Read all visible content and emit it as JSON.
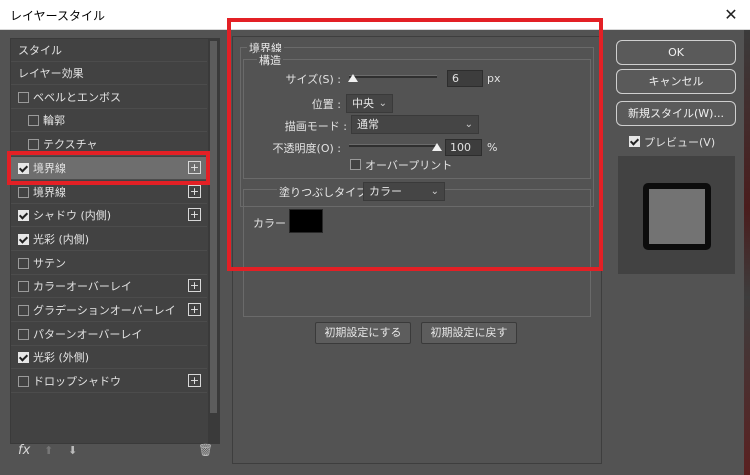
{
  "window": {
    "title": "レイヤースタイル",
    "close": "✕"
  },
  "left_panel": {
    "header_style": "スタイル",
    "header_effects": "レイヤー効果",
    "items": [
      {
        "label": "ベベルとエンボス",
        "checked": false,
        "plus": false
      },
      {
        "label": "輪郭",
        "checked": false,
        "plus": false
      },
      {
        "label": "テクスチャ",
        "checked": false,
        "plus": false
      },
      {
        "label": "境界線",
        "checked": true,
        "plus": true
      },
      {
        "label": "境界線",
        "checked": false,
        "plus": true
      },
      {
        "label": "シャドウ (内側)",
        "checked": true,
        "plus": true
      },
      {
        "label": "光彩 (内側)",
        "checked": true,
        "plus": false
      },
      {
        "label": "サテン",
        "checked": false,
        "plus": false
      },
      {
        "label": "カラーオーバーレイ",
        "checked": false,
        "plus": true
      },
      {
        "label": "グラデーションオーバーレイ",
        "checked": false,
        "plus": true
      },
      {
        "label": "パターンオーバーレイ",
        "checked": false,
        "plus": false
      },
      {
        "label": "光彩 (外側)",
        "checked": true,
        "plus": false
      },
      {
        "label": "ドロップシャドウ",
        "checked": false,
        "plus": true
      }
    ],
    "plus_symbol": "+",
    "fx": "fx",
    "up": "⬆",
    "down": "⬇",
    "trash": "🗑"
  },
  "stroke": {
    "title": "境界線",
    "structure_title": "構造",
    "size_label": "サイズ(S) :",
    "size_value": "6",
    "size_unit": "px",
    "position_label": "位置 :",
    "position_value": "中央",
    "blend_label": "描画モード :",
    "blend_value": "通常",
    "opacity_label": "不透明度(O) :",
    "opacity_value": "100",
    "opacity_unit": "%",
    "overprint_label": "オーバープリント",
    "fill_type_label": "塗りつぶしタイプ :",
    "fill_type_value": "カラー",
    "color_label": "カラー :",
    "color_value": "#000000",
    "reset_default": "初期設定にする",
    "restore_default": "初期設定に戻す",
    "chevron": "⌄"
  },
  "right_panel": {
    "ok": "OK",
    "cancel": "キャンセル",
    "new_style": "新規スタイル(W)...",
    "preview_label": "プレビュー(V)",
    "preview_checked": true
  },
  "accent": {
    "highlight": "#e32025"
  }
}
